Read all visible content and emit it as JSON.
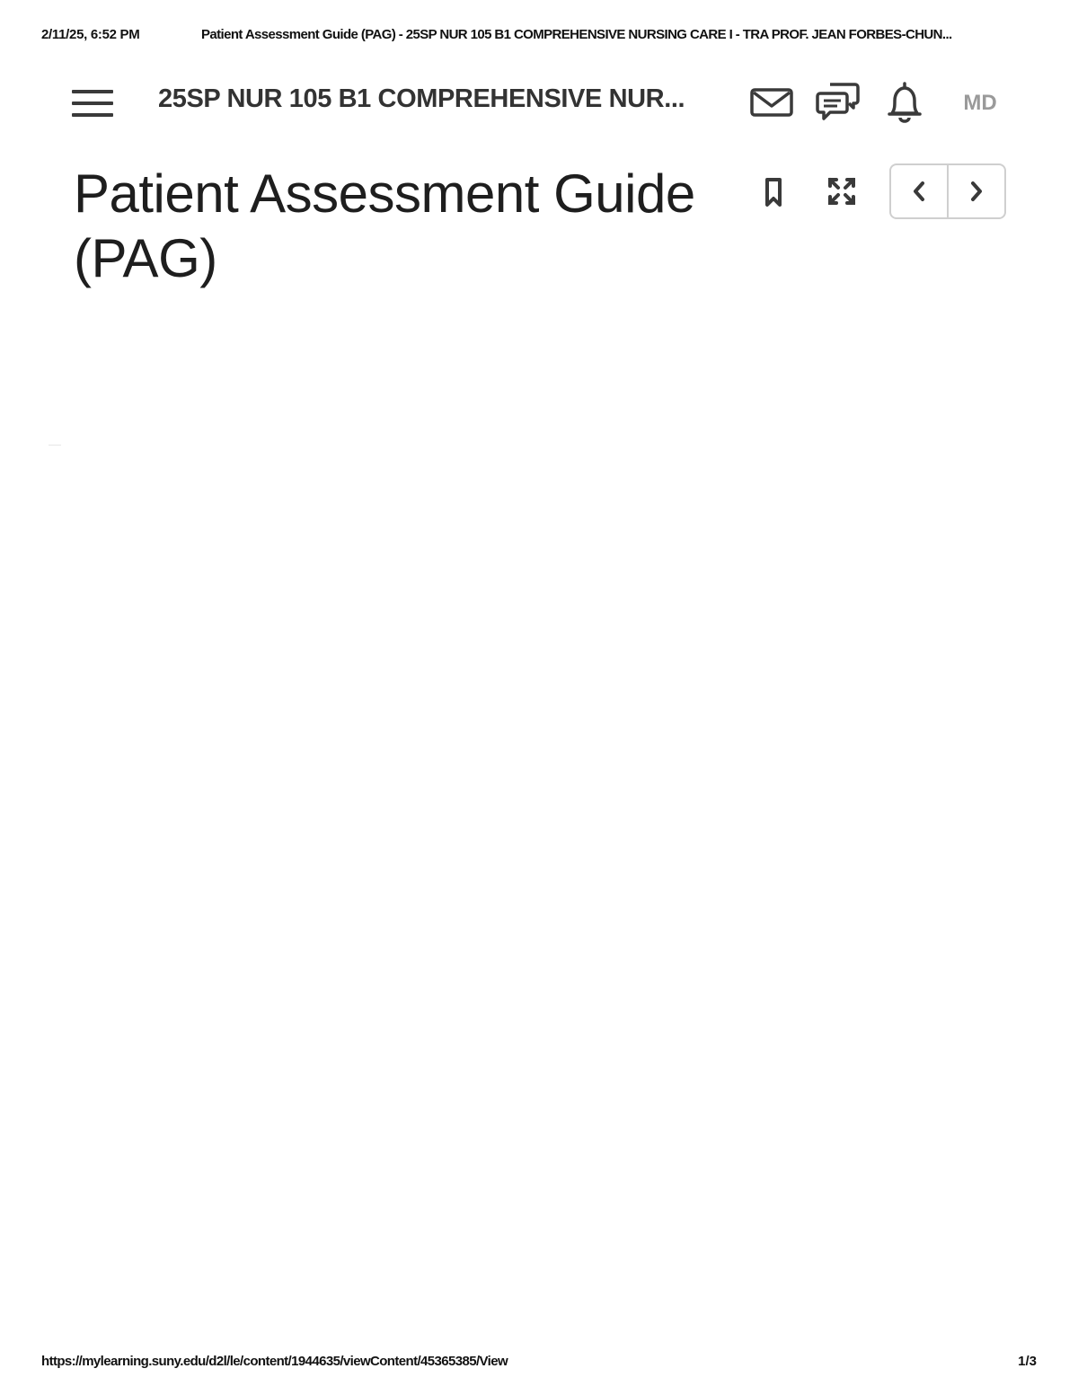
{
  "print_header": {
    "date": "2/11/25, 6:52 PM",
    "title": "Patient Assessment Guide (PAG) - 25SP NUR 105 B1 COMPREHENSIVE NURSING CARE I - TRA PROF. JEAN FORBES-CHUN..."
  },
  "navbar": {
    "menu_icon": "hamburger-menu-icon",
    "course_title": "25SP NUR 105 B1 COMPREHENSIVE NUR...",
    "icons": [
      "mail-icon",
      "chat-icon",
      "bell-icon"
    ],
    "avatar_initials": "MD"
  },
  "content": {
    "title": "Patient Assessment Guide (PAG)",
    "tools": [
      "bookmark-icon",
      "fullscreen-icon"
    ],
    "pager": [
      "chevron-left-icon",
      "chevron-right-icon"
    ]
  },
  "print_footer": {
    "url": "https://mylearning.suny.edu/d2l/le/content/1944635/viewContent/45365385/View",
    "page": "1/3"
  },
  "colors": {
    "text": "#1e1e1e",
    "icon": "#3a3a3a",
    "avatar": "#9a9a9a",
    "border": "#cfcfcf"
  }
}
